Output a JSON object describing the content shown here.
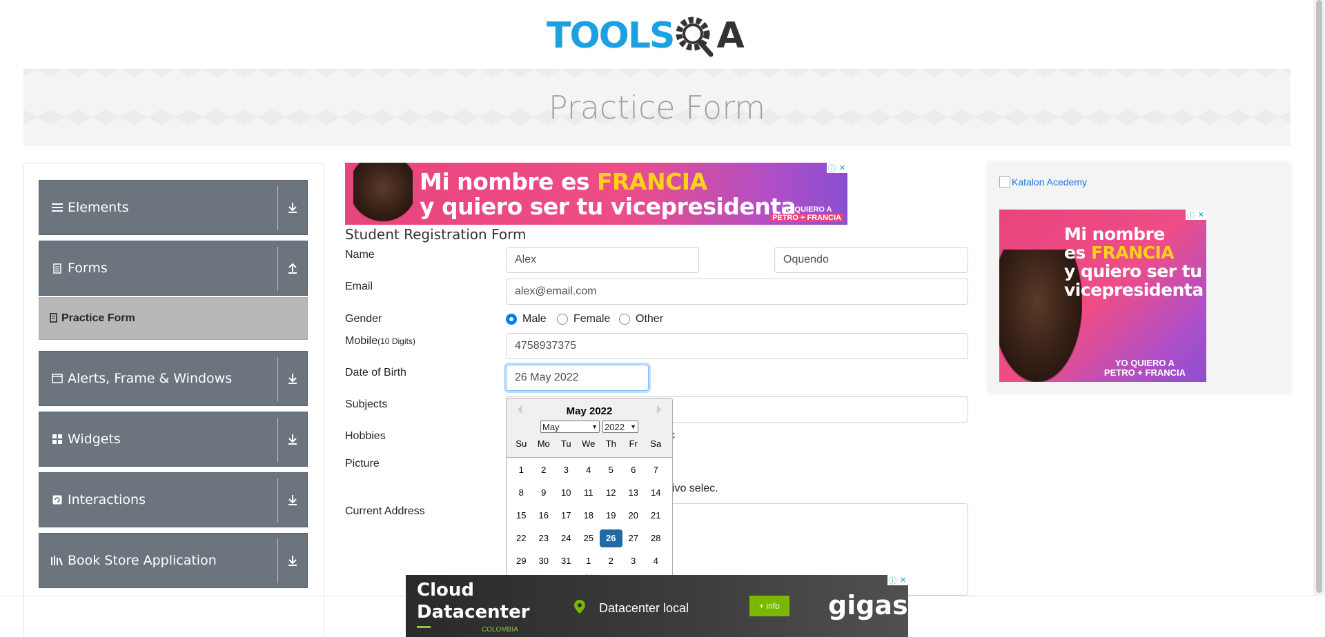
{
  "logo": {
    "brand_text": "TOOLSQA",
    "tools": "TOOLS",
    "qa": "QA"
  },
  "header": {
    "title": "Practice Form"
  },
  "sidebar": {
    "groups": [
      {
        "label": "Elements",
        "icon": "list-icon",
        "arrow": "download-icon"
      },
      {
        "label": "Forms",
        "icon": "document-icon",
        "arrow": "upload-icon"
      },
      {
        "label": "Alerts, Frame & Windows",
        "icon": "window-icon",
        "arrow": "download-icon"
      },
      {
        "label": "Widgets",
        "icon": "grid-icon",
        "arrow": "download-icon"
      },
      {
        "label": "Interactions",
        "icon": "interaction-icon",
        "arrow": "download-icon"
      },
      {
        "label": "Book Store Application",
        "icon": "books-icon",
        "arrow": "download-icon"
      }
    ],
    "active_item": {
      "label": "Practice Form",
      "icon": "document-icon"
    }
  },
  "top_ad": {
    "line1_a": "Mi nombre es ",
    "line1_b": "FRANCIA",
    "line2": "y quiero ser tu vicepresidenta",
    "tag1": "YO QUIERO A",
    "tag2": "PETRO + FRANCIA"
  },
  "form": {
    "title": "Student Registration Form",
    "labels": {
      "name": "Name",
      "email": "Email",
      "gender": "Gender",
      "mobile": "Mobile",
      "mobile_hint": "(10 Digits)",
      "dob": "Date of Birth",
      "subjects": "Subjects",
      "hobbies": "Hobbies",
      "picture": "Picture",
      "address": "Current Address"
    },
    "first_name": "Alex",
    "last_name": "Oquendo",
    "email": "alex@email.com",
    "gender_options": [
      "Male",
      "Female",
      "Other"
    ],
    "gender_selected": "Male",
    "mobile": "4758937375",
    "dob": "26 May 2022",
    "hobby_partial": "c",
    "file_partial": "hivo selec."
  },
  "datepicker": {
    "month_title": "May 2022",
    "month_select": "May",
    "year_select": "2022",
    "weekdays": [
      "Su",
      "Mo",
      "Tu",
      "We",
      "Th",
      "Fr",
      "Sa"
    ],
    "weeks": [
      [
        "1",
        "2",
        "3",
        "4",
        "5",
        "6",
        "7"
      ],
      [
        "8",
        "9",
        "10",
        "11",
        "12",
        "13",
        "14"
      ],
      [
        "15",
        "16",
        "17",
        "18",
        "19",
        "20",
        "21"
      ],
      [
        "22",
        "23",
        "24",
        "25",
        "26",
        "27",
        "28"
      ],
      [
        "29",
        "30",
        "31",
        "1",
        "2",
        "3",
        "4"
      ]
    ],
    "selected_day": "26"
  },
  "right_ad": {
    "alt_text": "Katalon Acedemy",
    "line1": "Mi nombre",
    "line2_a": "es ",
    "line2_b": "FRANCIA",
    "line3": "y quiero ser tu",
    "line4": "vicepresidenta",
    "tag1": "YO QUIERO A",
    "tag2": "PETRO + FRANCIA"
  },
  "bottom_ad": {
    "line1": "Cloud",
    "line2": "Datacenter",
    "country": "COLOMBIA",
    "feature": "Datacenter local",
    "button": "+ info",
    "brand": "gigas"
  },
  "ad_controls": {
    "info": "ⓘ",
    "close": "✕"
  },
  "colors": {
    "sidebar_bg": "#6c757d",
    "active_item_bg": "#b8b8b8",
    "accent": "#007bff",
    "logo_blue": "#1ba0e2",
    "selected_day": "#216ba5"
  }
}
